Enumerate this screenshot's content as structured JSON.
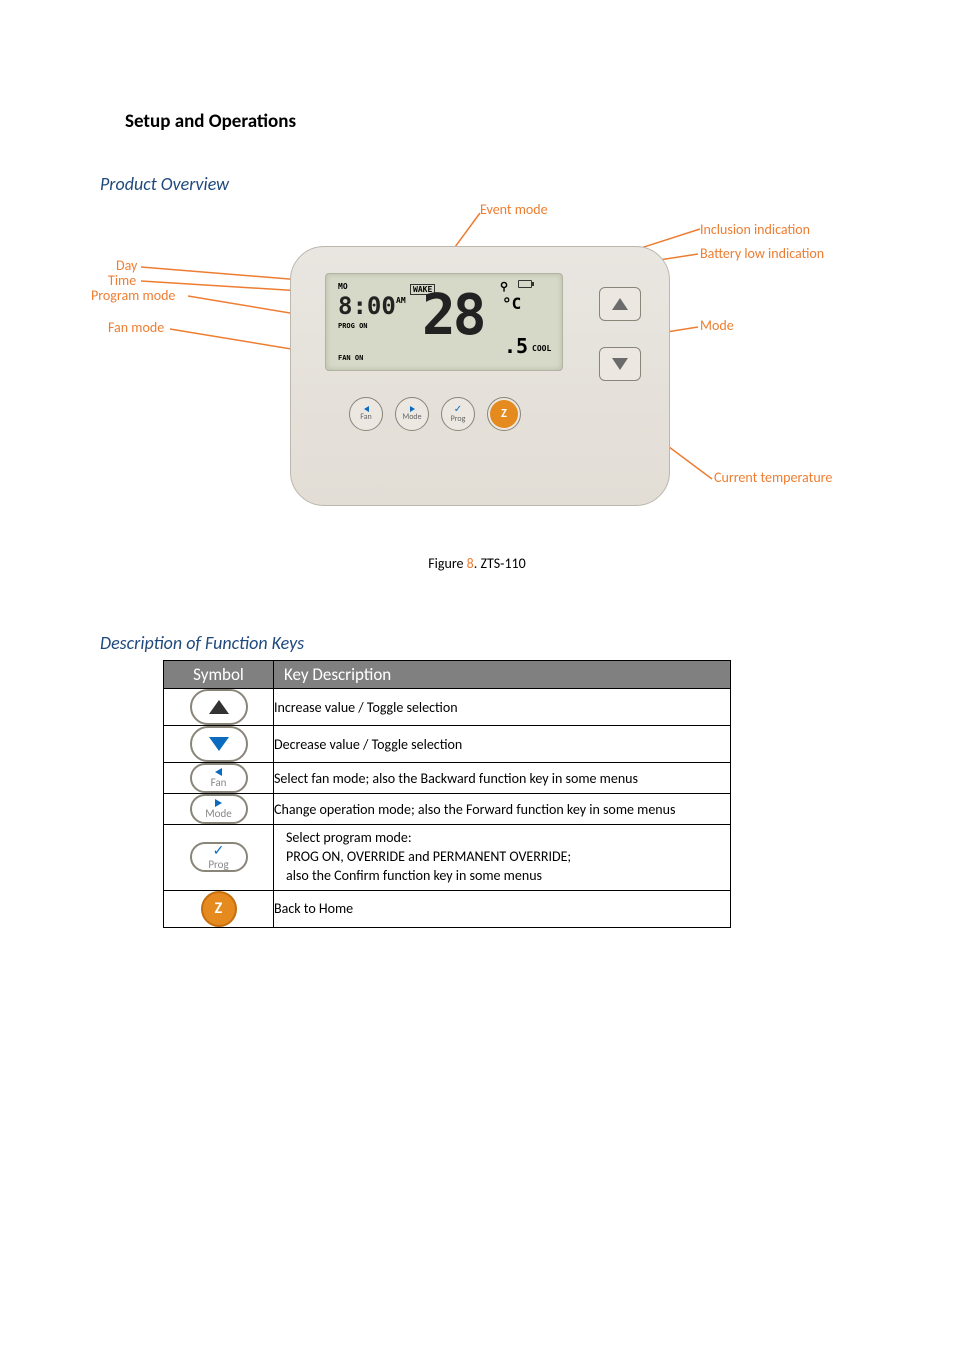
{
  "section_title": "Setup and Operations",
  "overview": {
    "heading": "Product Overview",
    "callouts": {
      "event_mode": "Event mode",
      "inclusion": "Inclusion indication",
      "battery_low": "Battery low indication",
      "day": "Day",
      "time": "Time",
      "program_mode": "Program mode",
      "fan_mode": "Fan mode",
      "mode": "Mode",
      "current_temp": "Current temperature"
    },
    "lcd": {
      "day": "MO",
      "time": "8:00",
      "ampm": "AM",
      "wake": "WAKE",
      "prog": "PROG ON",
      "fan": "FAN ON",
      "temp": "28",
      "unit": "°C",
      "setpoint": ".5",
      "cool": "COOL",
      "antenna": "⚲"
    },
    "buttons": {
      "fan": "Fan",
      "mode": "Mode",
      "prog": "Prog"
    }
  },
  "figure": {
    "label_prefix": "Figure ",
    "num": "8",
    "caption": ". ZTS-110"
  },
  "keys_section": {
    "heading": "Description of Function Keys",
    "col_symbol": "Symbol",
    "col_desc": "Key Description",
    "rows": {
      "up": "Increase value / Toggle selection",
      "down": "Decrease value / Toggle selection",
      "fan": "Select fan mode; also the Backward function key in some menus",
      "mode": "Change operation mode; also the Forward function key in some menus",
      "prog_l1": "Select program mode:",
      "prog_l2": "PROG ON, OVERRIDE and PERMANENT OVERRIDE;",
      "prog_l3": "also the Confirm function key in some menus",
      "home": "Back to Home"
    },
    "labels": {
      "fan": "Fan",
      "mode": "Mode",
      "prog": "Prog"
    }
  }
}
